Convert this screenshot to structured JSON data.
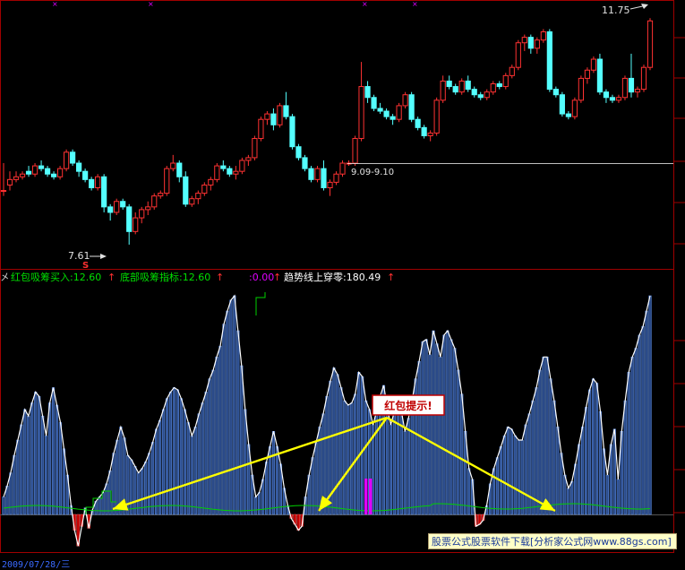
{
  "colors": {
    "up": "#ff3232",
    "down": "#54ffff",
    "grid": "#8a0000",
    "panel_border": "#a00000",
    "white_line": "#ffffff",
    "green_line": "#00d000",
    "bar_fill": "#2a4a88",
    "bar_stroke": "#5a8ae0",
    "arrow": "#ffff00",
    "callout_border": "#c00000",
    "callout_text": "#c00000",
    "magenta": "#e000ff",
    "red_fill": "#c00000"
  },
  "legend": {
    "item1": "红包吸筹买入:12.60",
    "item2": "底部吸筹指标:12.60",
    "item3": ":0.00",
    "item4": "趋势线上穿零:180.49"
  },
  "annotations": {
    "high_label": "11.75",
    "low_label": "7.61",
    "mid_label": "9.09-9.10",
    "s_mark": "S",
    "callout": "红包提示!"
  },
  "watermark": "股票公式股票软件下载[分析家公式网www.88gs.com]",
  "footer_date": "2009/07/28/三",
  "chart_data": [
    {
      "type": "candlestick",
      "ylim": [
        7.2,
        12.0
      ],
      "candles": [
        [
          8.6,
          9.1,
          8.5,
          8.6
        ],
        [
          8.7,
          8.95,
          8.6,
          8.8
        ],
        [
          8.8,
          8.95,
          8.75,
          8.85
        ],
        [
          8.85,
          8.95,
          8.8,
          8.9
        ],
        [
          8.95,
          9.05,
          8.85,
          8.9
        ],
        [
          8.9,
          9.1,
          8.85,
          9.05
        ],
        [
          9.05,
          9.15,
          8.95,
          9.0
        ],
        [
          9.0,
          9.05,
          8.85,
          8.9
        ],
        [
          8.9,
          8.95,
          8.8,
          8.85
        ],
        [
          8.85,
          9.05,
          8.8,
          9.0
        ],
        [
          9.0,
          9.35,
          8.95,
          9.3
        ],
        [
          9.3,
          9.35,
          9.05,
          9.1
        ],
        [
          9.1,
          9.15,
          8.85,
          8.95
        ],
        [
          8.95,
          9.0,
          8.75,
          8.8
        ],
        [
          8.8,
          8.85,
          8.6,
          8.65
        ],
        [
          8.65,
          8.9,
          8.6,
          8.85
        ],
        [
          8.85,
          8.9,
          8.2,
          8.3
        ],
        [
          8.3,
          8.35,
          8.05,
          8.2
        ],
        [
          8.2,
          8.45,
          8.15,
          8.4
        ],
        [
          8.4,
          8.45,
          8.25,
          8.3
        ],
        [
          8.3,
          8.35,
          7.61,
          7.85
        ],
        [
          7.85,
          8.2,
          7.8,
          8.1
        ],
        [
          8.1,
          8.3,
          8.0,
          8.25
        ],
        [
          8.25,
          8.4,
          8.15,
          8.3
        ],
        [
          8.3,
          8.55,
          8.25,
          8.5
        ],
        [
          8.5,
          8.6,
          8.45,
          8.55
        ],
        [
          8.55,
          9.05,
          8.5,
          9.0
        ],
        [
          9.0,
          9.25,
          8.95,
          9.1
        ],
        [
          9.1,
          9.15,
          8.75,
          8.85
        ],
        [
          8.85,
          8.95,
          8.3,
          8.35
        ],
        [
          8.35,
          8.5,
          8.3,
          8.45
        ],
        [
          8.45,
          8.6,
          8.35,
          8.55
        ],
        [
          8.55,
          8.75,
          8.5,
          8.7
        ],
        [
          8.7,
          8.85,
          8.6,
          8.8
        ],
        [
          8.8,
          9.1,
          8.75,
          9.05
        ],
        [
          9.05,
          9.15,
          8.95,
          9.0
        ],
        [
          9.0,
          9.05,
          8.85,
          8.9
        ],
        [
          8.9,
          9.05,
          8.8,
          8.95
        ],
        [
          8.95,
          9.2,
          8.9,
          9.15
        ],
        [
          9.15,
          9.25,
          9.05,
          9.2
        ],
        [
          9.2,
          9.6,
          9.15,
          9.55
        ],
        [
          9.55,
          9.95,
          9.5,
          9.9
        ],
        [
          9.9,
          10.05,
          9.8,
          10.0
        ],
        [
          10.0,
          10.1,
          9.7,
          9.8
        ],
        [
          9.8,
          10.2,
          9.75,
          10.15
        ],
        [
          10.15,
          10.4,
          9.9,
          9.95
        ],
        [
          9.95,
          10.0,
          9.35,
          9.4
        ],
        [
          9.4,
          9.45,
          9.15,
          9.2
        ],
        [
          9.2,
          9.25,
          8.95,
          9.0
        ],
        [
          9.0,
          9.05,
          8.75,
          8.8
        ],
        [
          8.8,
          9.05,
          8.75,
          9.0
        ],
        [
          9.0,
          9.15,
          8.6,
          8.65
        ],
        [
          8.65,
          8.8,
          8.5,
          8.75
        ],
        [
          8.75,
          8.95,
          8.7,
          8.9
        ],
        [
          8.9,
          9.15,
          8.85,
          9.1
        ],
        [
          9.1,
          9.15,
          9.05,
          9.1
        ],
        [
          9.1,
          9.6,
          9.05,
          9.55
        ],
        [
          9.55,
          10.95,
          9.5,
          10.5
        ],
        [
          10.5,
          10.6,
          10.2,
          10.3
        ],
        [
          10.3,
          10.35,
          10.05,
          10.1
        ],
        [
          10.1,
          10.2,
          10.0,
          10.05
        ],
        [
          10.05,
          10.1,
          9.9,
          9.95
        ],
        [
          9.95,
          10.0,
          9.8,
          9.9
        ],
        [
          9.9,
          10.2,
          9.85,
          10.15
        ],
        [
          10.15,
          10.4,
          10.1,
          10.35
        ],
        [
          10.35,
          10.4,
          9.85,
          9.9
        ],
        [
          9.9,
          9.95,
          9.7,
          9.75
        ],
        [
          9.75,
          9.8,
          9.55,
          9.6
        ],
        [
          9.6,
          9.7,
          9.5,
          9.65
        ],
        [
          9.65,
          10.3,
          9.6,
          10.25
        ],
        [
          10.25,
          10.7,
          10.2,
          10.6
        ],
        [
          10.6,
          10.7,
          10.45,
          10.5
        ],
        [
          10.5,
          10.55,
          10.35,
          10.4
        ],
        [
          10.4,
          10.65,
          10.35,
          10.6
        ],
        [
          10.6,
          10.7,
          10.4,
          10.45
        ],
        [
          10.45,
          10.5,
          10.3,
          10.35
        ],
        [
          10.35,
          10.4,
          10.25,
          10.3
        ],
        [
          10.3,
          10.45,
          10.25,
          10.4
        ],
        [
          10.4,
          10.6,
          10.35,
          10.55
        ],
        [
          10.55,
          10.6,
          10.45,
          10.5
        ],
        [
          10.5,
          10.75,
          10.45,
          10.7
        ],
        [
          10.7,
          10.9,
          10.65,
          10.85
        ],
        [
          10.85,
          11.35,
          10.8,
          11.3
        ],
        [
          11.3,
          11.45,
          11.15,
          11.4
        ],
        [
          11.4,
          11.45,
          11.1,
          11.2
        ],
        [
          11.2,
          11.4,
          11.1,
          11.35
        ],
        [
          11.35,
          11.55,
          11.3,
          11.5
        ],
        [
          11.5,
          11.55,
          10.4,
          10.45
        ],
        [
          10.45,
          10.5,
          10.3,
          10.35
        ],
        [
          10.35,
          10.4,
          9.95,
          10.0
        ],
        [
          10.0,
          10.05,
          9.9,
          9.95
        ],
        [
          9.95,
          10.3,
          9.9,
          10.25
        ],
        [
          10.25,
          10.7,
          10.2,
          10.65
        ],
        [
          10.65,
          10.85,
          10.55,
          10.8
        ],
        [
          10.8,
          11.05,
          10.75,
          11.0
        ],
        [
          11.0,
          11.1,
          10.35,
          10.4
        ],
        [
          10.4,
          10.45,
          10.2,
          10.3
        ],
        [
          10.3,
          10.35,
          10.2,
          10.25
        ],
        [
          10.25,
          10.35,
          10.2,
          10.3
        ],
        [
          10.3,
          10.7,
          10.25,
          10.65
        ],
        [
          10.65,
          11.1,
          10.3,
          10.4
        ],
        [
          10.4,
          10.5,
          10.3,
          10.45
        ],
        [
          10.45,
          10.9,
          10.4,
          10.85
        ],
        [
          10.85,
          11.75,
          10.8,
          11.7
        ]
      ]
    },
    {
      "type": "bar",
      "ylim": [
        0,
        100
      ],
      "series": [
        {
          "values": [
            8,
            13,
            19,
            27,
            34,
            41,
            48,
            45,
            51,
            56,
            54,
            45,
            36,
            51,
            58,
            50,
            42,
            30,
            18,
            4,
            -8,
            -16,
            -6,
            3,
            -7,
            2,
            6,
            8,
            10,
            14,
            20,
            28,
            34,
            40,
            35,
            27,
            25,
            22,
            19,
            21,
            24,
            28,
            33,
            39,
            43,
            48,
            53,
            56,
            58,
            57,
            53,
            48,
            42,
            36,
            40,
            46,
            51,
            56,
            62,
            66,
            72,
            77,
            87,
            93,
            98,
            100,
            84,
            68,
            48,
            32,
            18,
            8,
            10,
            16,
            24,
            31,
            38,
            31,
            23,
            12,
            4,
            -2,
            -5,
            -8,
            -6,
            8,
            18,
            26,
            33,
            40,
            46,
            54,
            61,
            67,
            64,
            58,
            52,
            50,
            51,
            55,
            65,
            63,
            52,
            48,
            41,
            47,
            54,
            59,
            49,
            41,
            47,
            52,
            47,
            38,
            44,
            52,
            62,
            70,
            79,
            80,
            73,
            84,
            78,
            72,
            82,
            84,
            80,
            76,
            66,
            55,
            38,
            21,
            16,
            -6,
            -5,
            -3,
            4,
            14,
            21,
            26,
            31,
            36,
            40,
            39,
            36,
            34,
            34,
            41,
            46,
            52,
            58,
            66,
            72,
            72,
            62,
            52,
            40,
            28,
            18,
            12,
            15,
            23,
            32,
            40,
            49,
            57,
            62,
            60,
            47,
            30,
            18,
            32,
            39,
            16,
            38,
            52,
            65,
            72,
            76,
            82,
            86,
            93,
            100
          ]
        }
      ]
    }
  ]
}
